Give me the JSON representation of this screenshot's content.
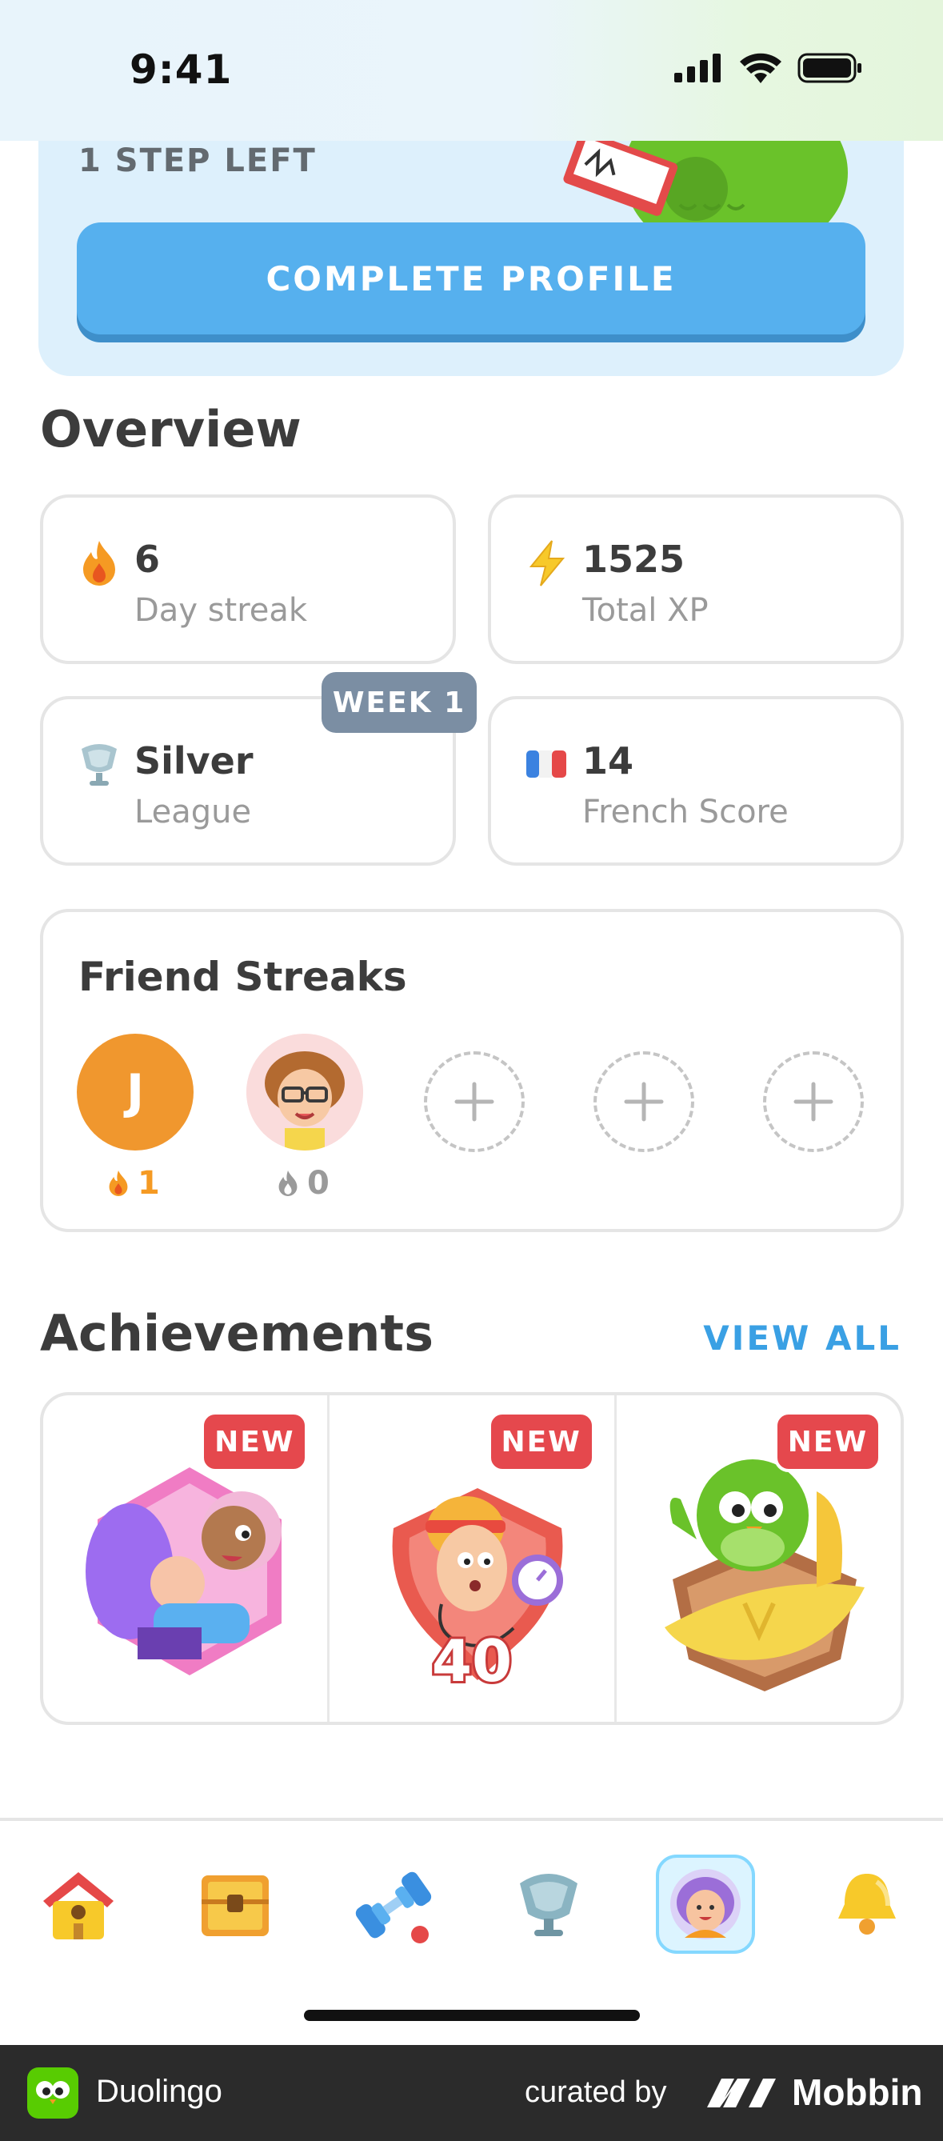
{
  "status_bar": {
    "time": "9:41"
  },
  "profile_prompt": {
    "steps_left": "1 STEP LEFT",
    "button_label": "COMPLETE PROFILE"
  },
  "overview": {
    "title": "Overview",
    "stats": [
      {
        "value": "6",
        "label": "Day streak",
        "icon": "flame-icon"
      },
      {
        "value": "1525",
        "label": "Total XP",
        "icon": "lightning-icon"
      },
      {
        "value": "Silver",
        "label": "League",
        "icon": "silver-trophy-icon",
        "badge": "WEEK 1"
      },
      {
        "value": "14",
        "label": "French Score",
        "icon": "french-flag-icon"
      }
    ]
  },
  "friend_streaks": {
    "title": "Friend Streaks",
    "friends": [
      {
        "initial": "J",
        "count": "1",
        "active": true
      },
      {
        "initial": "",
        "count": "0",
        "active": false
      }
    ],
    "empty_slots": 3
  },
  "achievements": {
    "title": "Achievements",
    "view_all": "VIEW ALL",
    "items": [
      {
        "badge": "NEW",
        "icon": "friends-hug-achievement-icon"
      },
      {
        "badge": "NEW",
        "number": "40",
        "icon": "stopwatch-achievement-icon"
      },
      {
        "badge": "NEW",
        "icon": "owl-trophy-achievement-icon"
      }
    ]
  },
  "tab_bar": {
    "tabs": [
      {
        "name": "home-icon"
      },
      {
        "name": "treasure-chest-icon"
      },
      {
        "name": "dumbbell-icon"
      },
      {
        "name": "trophy-icon"
      },
      {
        "name": "profile-icon",
        "active": true
      },
      {
        "name": "bell-icon"
      }
    ]
  },
  "footer": {
    "app_name": "Duolingo",
    "curated_by": "curated by",
    "brand": "Mobbin"
  }
}
